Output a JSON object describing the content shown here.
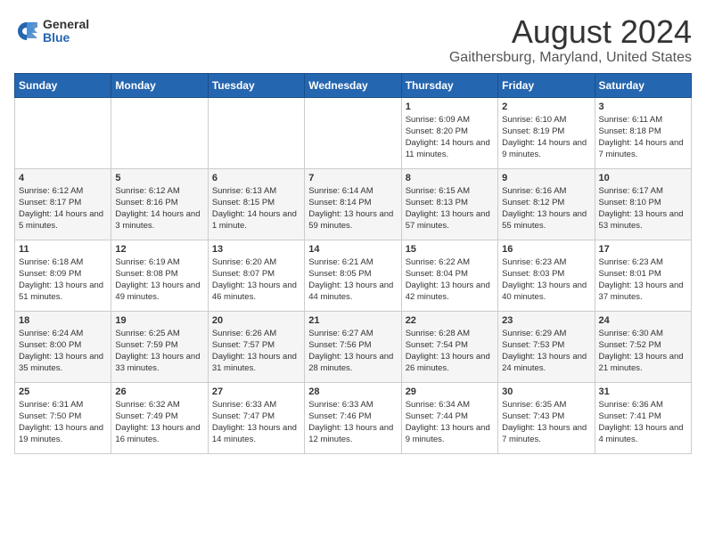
{
  "logo": {
    "general": "General",
    "blue": "Blue"
  },
  "title": "August 2024",
  "location": "Gaithersburg, Maryland, United States",
  "headers": [
    "Sunday",
    "Monday",
    "Tuesday",
    "Wednesday",
    "Thursday",
    "Friday",
    "Saturday"
  ],
  "weeks": [
    [
      {
        "day": "",
        "info": ""
      },
      {
        "day": "",
        "info": ""
      },
      {
        "day": "",
        "info": ""
      },
      {
        "day": "",
        "info": ""
      },
      {
        "day": "1",
        "info": "Sunrise: 6:09 AM\nSunset: 8:20 PM\nDaylight: 14 hours and 11 minutes."
      },
      {
        "day": "2",
        "info": "Sunrise: 6:10 AM\nSunset: 8:19 PM\nDaylight: 14 hours and 9 minutes."
      },
      {
        "day": "3",
        "info": "Sunrise: 6:11 AM\nSunset: 8:18 PM\nDaylight: 14 hours and 7 minutes."
      }
    ],
    [
      {
        "day": "4",
        "info": "Sunrise: 6:12 AM\nSunset: 8:17 PM\nDaylight: 14 hours and 5 minutes."
      },
      {
        "day": "5",
        "info": "Sunrise: 6:12 AM\nSunset: 8:16 PM\nDaylight: 14 hours and 3 minutes."
      },
      {
        "day": "6",
        "info": "Sunrise: 6:13 AM\nSunset: 8:15 PM\nDaylight: 14 hours and 1 minute."
      },
      {
        "day": "7",
        "info": "Sunrise: 6:14 AM\nSunset: 8:14 PM\nDaylight: 13 hours and 59 minutes."
      },
      {
        "day": "8",
        "info": "Sunrise: 6:15 AM\nSunset: 8:13 PM\nDaylight: 13 hours and 57 minutes."
      },
      {
        "day": "9",
        "info": "Sunrise: 6:16 AM\nSunset: 8:12 PM\nDaylight: 13 hours and 55 minutes."
      },
      {
        "day": "10",
        "info": "Sunrise: 6:17 AM\nSunset: 8:10 PM\nDaylight: 13 hours and 53 minutes."
      }
    ],
    [
      {
        "day": "11",
        "info": "Sunrise: 6:18 AM\nSunset: 8:09 PM\nDaylight: 13 hours and 51 minutes."
      },
      {
        "day": "12",
        "info": "Sunrise: 6:19 AM\nSunset: 8:08 PM\nDaylight: 13 hours and 49 minutes."
      },
      {
        "day": "13",
        "info": "Sunrise: 6:20 AM\nSunset: 8:07 PM\nDaylight: 13 hours and 46 minutes."
      },
      {
        "day": "14",
        "info": "Sunrise: 6:21 AM\nSunset: 8:05 PM\nDaylight: 13 hours and 44 minutes."
      },
      {
        "day": "15",
        "info": "Sunrise: 6:22 AM\nSunset: 8:04 PM\nDaylight: 13 hours and 42 minutes."
      },
      {
        "day": "16",
        "info": "Sunrise: 6:23 AM\nSunset: 8:03 PM\nDaylight: 13 hours and 40 minutes."
      },
      {
        "day": "17",
        "info": "Sunrise: 6:23 AM\nSunset: 8:01 PM\nDaylight: 13 hours and 37 minutes."
      }
    ],
    [
      {
        "day": "18",
        "info": "Sunrise: 6:24 AM\nSunset: 8:00 PM\nDaylight: 13 hours and 35 minutes."
      },
      {
        "day": "19",
        "info": "Sunrise: 6:25 AM\nSunset: 7:59 PM\nDaylight: 13 hours and 33 minutes."
      },
      {
        "day": "20",
        "info": "Sunrise: 6:26 AM\nSunset: 7:57 PM\nDaylight: 13 hours and 31 minutes."
      },
      {
        "day": "21",
        "info": "Sunrise: 6:27 AM\nSunset: 7:56 PM\nDaylight: 13 hours and 28 minutes."
      },
      {
        "day": "22",
        "info": "Sunrise: 6:28 AM\nSunset: 7:54 PM\nDaylight: 13 hours and 26 minutes."
      },
      {
        "day": "23",
        "info": "Sunrise: 6:29 AM\nSunset: 7:53 PM\nDaylight: 13 hours and 24 minutes."
      },
      {
        "day": "24",
        "info": "Sunrise: 6:30 AM\nSunset: 7:52 PM\nDaylight: 13 hours and 21 minutes."
      }
    ],
    [
      {
        "day": "25",
        "info": "Sunrise: 6:31 AM\nSunset: 7:50 PM\nDaylight: 13 hours and 19 minutes."
      },
      {
        "day": "26",
        "info": "Sunrise: 6:32 AM\nSunset: 7:49 PM\nDaylight: 13 hours and 16 minutes."
      },
      {
        "day": "27",
        "info": "Sunrise: 6:33 AM\nSunset: 7:47 PM\nDaylight: 13 hours and 14 minutes."
      },
      {
        "day": "28",
        "info": "Sunrise: 6:33 AM\nSunset: 7:46 PM\nDaylight: 13 hours and 12 minutes."
      },
      {
        "day": "29",
        "info": "Sunrise: 6:34 AM\nSunset: 7:44 PM\nDaylight: 13 hours and 9 minutes."
      },
      {
        "day": "30",
        "info": "Sunrise: 6:35 AM\nSunset: 7:43 PM\nDaylight: 13 hours and 7 minutes."
      },
      {
        "day": "31",
        "info": "Sunrise: 6:36 AM\nSunset: 7:41 PM\nDaylight: 13 hours and 4 minutes."
      }
    ]
  ]
}
